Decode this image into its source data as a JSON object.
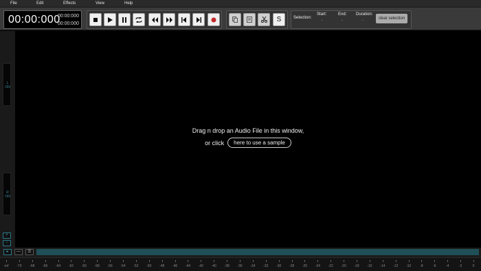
{
  "menu": [
    "File",
    "Edit",
    "Effects",
    "View",
    "Help"
  ],
  "time": {
    "main": "00:00:000",
    "sub1": "00:00:000",
    "sub2": "00:00:000"
  },
  "transport": [
    {
      "name": "stop-icon"
    },
    {
      "name": "play-icon"
    },
    {
      "name": "pause-icon"
    },
    {
      "name": "loop-icon"
    },
    {
      "name": "rewind-icon"
    },
    {
      "name": "fast-forward-icon"
    },
    {
      "name": "skip-start-icon"
    },
    {
      "name": "skip-end-icon"
    },
    {
      "name": "record-icon"
    }
  ],
  "edit_tools": [
    {
      "name": "copy-icon"
    },
    {
      "name": "paste-icon"
    },
    {
      "name": "scissors-icon"
    },
    {
      "name": "s-icon",
      "label": "S"
    }
  ],
  "selection": {
    "label": "Selection:",
    "start_label": "Start:",
    "start_value": "-",
    "end_label": "End:",
    "end_value": "-",
    "duration_label": "Duration:",
    "duration_value": "-",
    "clear_label": "clear selection"
  },
  "channels": {
    "left": {
      "name": "L",
      "state": "ON"
    },
    "right": {
      "name": "R",
      "state": "ON"
    }
  },
  "side_controls": [
    "+",
    "−"
  ],
  "drop": {
    "line1": "Drag n drop an Audio File in this window,",
    "or_click": "or click",
    "sample_button": "here to use a sample"
  },
  "bottom_buttons": [
    "▸",
    "—",
    "☰"
  ],
  "ruler_labels": [
    "-inf",
    "-70",
    "-68",
    "-66",
    "-64",
    "-62",
    "-60",
    "-58",
    "-56",
    "-54",
    "-52",
    "-50",
    "-48",
    "-46",
    "-44",
    "-42",
    "-40",
    "-38",
    "-36",
    "-34",
    "-32",
    "-30",
    "-28",
    "-26",
    "-24",
    "-22",
    "-20",
    "-18",
    "-16",
    "-14",
    "-12",
    "-10",
    "-8",
    "-6",
    "-4",
    "-2",
    "0"
  ],
  "colors": {
    "accent": "#3a9aaa",
    "scroll": "#1f4f57",
    "record": "#c42a2a"
  }
}
